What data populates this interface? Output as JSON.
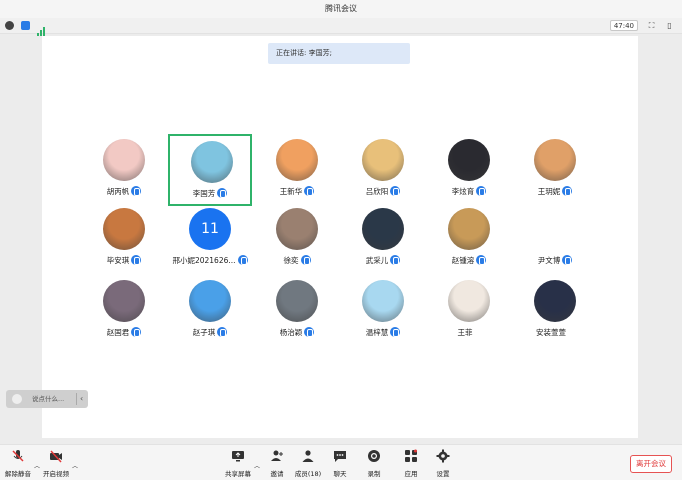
{
  "window": {
    "title": "腾讯会议"
  },
  "infobar": {
    "timer": "47:40"
  },
  "speaking": "正在讲话: 李国芳;",
  "participants": [
    {
      "name": "胡丙帆",
      "avatar": "photo",
      "color": "#f2c9c4"
    },
    {
      "name": "李国芳",
      "avatar": "photo",
      "color": "#7fc4e0",
      "selected": true
    },
    {
      "name": "王新华",
      "avatar": "photo",
      "color": "#f0a060"
    },
    {
      "name": "吕欣阳",
      "avatar": "photo",
      "color": "#e8c07a"
    },
    {
      "name": "李炫育",
      "avatar": "photo",
      "color": "#2a2a30"
    },
    {
      "name": "王玥妮",
      "avatar": "photo",
      "color": "#e0a068"
    },
    {
      "name": "毕安琪",
      "avatar": "photo",
      "color": "#c87840"
    },
    {
      "name": "邢小妮2021626...",
      "avatar": "number",
      "number": "11"
    },
    {
      "name": "徐奕",
      "avatar": "photo",
      "color": "#9a8070"
    },
    {
      "name": "武采儿",
      "avatar": "photo",
      "color": "#2a3848"
    },
    {
      "name": "赵锺溶",
      "avatar": "photo",
      "color": "#c89a58"
    },
    {
      "name": "尹文博",
      "avatar": "photo",
      "color": "#ffffff"
    },
    {
      "name": "赵国君",
      "avatar": "photo",
      "color": "#7a6a7a"
    },
    {
      "name": "赵子琪",
      "avatar": "photo",
      "color": "#4aa0e8"
    },
    {
      "name": "杨治颖",
      "avatar": "photo",
      "color": "#707880"
    },
    {
      "name": "温梓慧",
      "avatar": "photo",
      "color": "#a8d8f0"
    },
    {
      "name": "王菲",
      "avatar": "photo",
      "color": "#f0e8e0",
      "muted": true
    },
    {
      "name": "安装萱萱",
      "avatar": "photo",
      "color": "#283048",
      "signal": true
    }
  ],
  "comment": {
    "placeholder": "说点什么..."
  },
  "toolbar": {
    "unmute": "解除静音",
    "start_video": "开启视频",
    "share": "共享屏幕",
    "invite": "邀请",
    "members": "成员(18)",
    "chat": "聊天",
    "record": "录制",
    "apps": "应用",
    "settings": "设置",
    "leave": "离开会议"
  }
}
